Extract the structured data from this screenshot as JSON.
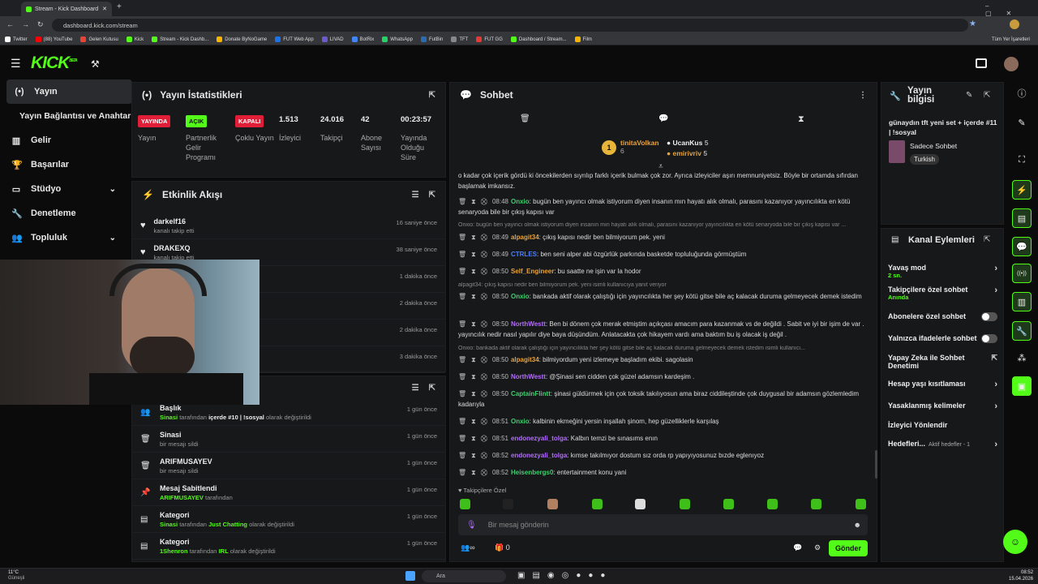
{
  "browser": {
    "tab_title": "Stream - Kick Dashboard",
    "url": "dashboard.kick.com/stream",
    "bookmarks": [
      "Twitter",
      "(88) YouTube",
      "Gelen Kutusu",
      "Kick",
      "Stream - Kick Dashb...",
      "Donate ByNoGame",
      "FUT Web App",
      "LIVAD",
      "BotRix",
      "WhatsApp",
      "FutBin",
      "TFT",
      "FUT GG",
      "Dashboard / Stream...",
      "Film"
    ],
    "all_bookmarks": "Tüm Yer İşaretleri"
  },
  "app": {
    "logo": "KICK",
    "beta": "BETA"
  },
  "sidebar": {
    "items": [
      {
        "label": "Yayın",
        "icon": "(•)"
      },
      {
        "label": "Yayın Bağlantısı ve Anahtarı",
        "icon": ""
      },
      {
        "label": "Gelir",
        "icon": "▥"
      },
      {
        "label": "Başarılar",
        "icon": "🏆"
      },
      {
        "label": "Stüdyo",
        "icon": "▭"
      },
      {
        "label": "Denetleme",
        "icon": "🔧"
      },
      {
        "label": "Topluluk",
        "icon": "👥"
      }
    ]
  },
  "stats": {
    "title": "Yayın İstatistikleri",
    "items": [
      {
        "badge": "YAYINDA",
        "label": "Yayın"
      },
      {
        "badge": "AÇIK",
        "label": "Partnerlik Gelir Programı"
      },
      {
        "badge": "KAPALI",
        "label": "Çoklu Yayın"
      },
      {
        "value": "1.513",
        "label": "İzleyici"
      },
      {
        "value": "24.016",
        "label": "Takipçi"
      },
      {
        "value": "42",
        "label": "Abone Sayısı"
      },
      {
        "value": "00:23:57",
        "label": "Yayında Olduğu Süre"
      }
    ]
  },
  "activity": {
    "title": "Etkinlik Akışı",
    "items": [
      {
        "name": "darkelf16",
        "sub": "kanalı takip etti",
        "time": "16 saniye önce"
      },
      {
        "name": "DRAKEXQ",
        "sub": "kanalı takip etti",
        "time": "38 saniye önce"
      },
      {
        "name": "",
        "sub": "",
        "time": "1 dakika önce"
      },
      {
        "name": "",
        "sub": "",
        "time": "2 dakika önce"
      },
      {
        "name": "",
        "sub": "",
        "time": "2 dakika önce"
      },
      {
        "name": "",
        "sub": "",
        "time": "3 dakika önce"
      }
    ]
  },
  "modlog": {
    "items": [
      {
        "name": "Başlık",
        "sub_user": "Sinasi",
        "sub_text": "tarafından",
        "sub_bold": "içerde #10 | !sosyal",
        "sub_end": "olarak değiştirildi",
        "time": "1 gün önce",
        "icon": "👥"
      },
      {
        "name": "Sinasi",
        "sub_text": "bir mesajı sildi",
        "time": "1 gün önce",
        "icon": "🗑"
      },
      {
        "name": "ARIFMUSAYEV",
        "sub_text": "bir mesajı sildi",
        "time": "1 gün önce",
        "icon": "🗑"
      },
      {
        "name": "Mesaj Sabitlendi",
        "sub_user": "ARIFMUSAYEV",
        "sub_text": "tarafından",
        "time": "1 gün önce",
        "icon": "📌"
      },
      {
        "name": "Kategori",
        "sub_user": "Sinasi",
        "sub_text": "tarafından",
        "sub_bold": "Just Chatting",
        "sub_end": "olarak değiştirildi",
        "time": "1 gün önce",
        "icon": "▤"
      },
      {
        "name": "Kategori",
        "sub_user": "1Shenron",
        "sub_text": "tarafından",
        "sub_bold": "IRL",
        "sub_end": "olarak değiştirildi",
        "time": "1 gün önce",
        "icon": "▤"
      }
    ]
  },
  "chat": {
    "title": "Sohbet",
    "top1": {
      "name": "tinitaVolkan",
      "count": "6"
    },
    "top2": {
      "name": "UcanKus",
      "count": "5"
    },
    "top3": {
      "name": "emirivriv",
      "count": "5"
    },
    "first_line": "o kadar çok içerik gördü ki öncekilerden sıyrılıp farklı içerik bulmak çok zor. Ayrıca izleyiciler aşırı memnuniyetsiz. Böyle bir ortamda sıfırdan başlamak imkansız.",
    "messages": [
      {
        "time": "08:48",
        "user": "Onxio",
        "color": "#3fcf6f",
        "text": "bugün ben yayıncı olmak istiyorum diyen insanın mın hayatı alık olmalı, parasını kazanıyor yayıncılıkta en kötü senaryoda bile bir çıkış kapısı var"
      },
      {
        "time": "08:49",
        "user": "alpagit34",
        "color": "#e8a33b",
        "text": "çıkış kapısı nedir ben bilmiyorum pek. yeni"
      },
      {
        "time": "08:49",
        "user": "CTRLES",
        "color": "#4a7eff",
        "text": "ben seni alper abi özgürlük parkında basketde topluluğunda görmüştüm"
      },
      {
        "time": "08:50",
        "user": "Self_Engineer",
        "color": "#e8a33b",
        "text": "bu saatte ne işin var la hodor"
      },
      {
        "time": "08:50",
        "user": "Onxio",
        "color": "#3fcf6f",
        "text": "bankada aktif olarak çalıştığı için yayıncılıkta her şey kötü gitse bile aç kalacak duruma gelmeyecek demek istedim"
      },
      {
        "time": "08:50",
        "user": "NorthWestt",
        "color": "#b36bff",
        "text": "Ben bi dönem çok merak etmiştim açıkçası amacım para kazanmak vs de değildi . Sabit ve iyi bir işim de var . yayıncılık nedir nasıl yapılır diye baya düşündüm. Anlatacakta çok hikayem vardı ama baktım bu iş olacak iş değil ."
      },
      {
        "time": "08:50",
        "user": "alpagit34",
        "color": "#e8a33b",
        "text": "bilmiyordum yeni izlemeye başladım ekibi. sagolasin"
      },
      {
        "time": "08:50",
        "user": "NorthWestt",
        "color": "#b36bff",
        "text": "@Şinasi sen cidden çok güzel adamsın kardeşim ."
      },
      {
        "time": "08:50",
        "user": "CaptainFlintt",
        "color": "#3fcf6f",
        "text": "şinasi güldürmek için çok toksik takılıyosun ama biraz ciddileştinde çok duygusal bir adamsın gözlemledim kadarıyla"
      },
      {
        "time": "08:51",
        "user": "Onxio",
        "color": "#3fcf6f",
        "text": "kalbinin ekmeğini yersin inşallah şinom, hep güzelliklerle karşılaş"
      },
      {
        "time": "08:51",
        "user": "endonezyali_tolga",
        "color": "#b36bff",
        "text": "Kalbın temzi be sınasıms enın"
      },
      {
        "time": "08:52",
        "user": "endonezyali_tolga",
        "color": "#b36bff",
        "text": "kımse takılmıyor dostum sız orda rp yapıyıyosunuz bızde eglenıyoz"
      },
      {
        "time": "08:52",
        "user": "Heisenbergs0",
        "color": "#3fcf6f",
        "text": "entertainment konu yani"
      }
    ],
    "replies": [
      "Onxio: bugün ben yayıncı olmak istiyorum diyen insanın mın hayatı alık olmalı, parasını kazanıyor yayıncılıkta en kötü senaryoda bile bir çıkış kapısı var ...",
      "alpagit34: çıkış kapısı nedir ben bilmiyorum pek. yeni isimli kullanıcıya yanıt veriyor",
      "Onxio: bankada aktif olarak çalıştığı için yayıncılıkta her şey kötü gitse bile aç kalacak duruma gelmeyecek demek istedim isimli kullanıcı..."
    ],
    "followers_only": "Takipçilere Özel",
    "input_placeholder": "Bir mesaj gönderin",
    "send_label": "Gönder",
    "pts": "0"
  },
  "streaminfo": {
    "title": "Yayın bilgisi",
    "stream_title": "günaydın tft yeni set + içerde #11 | !sosyal",
    "category": "Sadece Sohbet",
    "language": "Turkish"
  },
  "channel": {
    "title": "Kanal Eylemleri",
    "actions": [
      {
        "label": "Yavaş mod",
        "sub": "2 sn.",
        "kind": "chev"
      },
      {
        "label": "Takipçilere özel sohbet",
        "sub": "Anında",
        "kind": "chev"
      },
      {
        "label": "Abonelere özel sohbet",
        "kind": "toggle"
      },
      {
        "label": "Yalnızca ifadelerle sohbet",
        "kind": "toggle"
      },
      {
        "label": "Yapay Zeka ile Sohbet Denetimi",
        "kind": "ext"
      },
      {
        "label": "Hesap yaşı kısıtlaması",
        "kind": "chev"
      },
      {
        "label": "Yasaklanmış kelimeler",
        "kind": "chev"
      },
      {
        "label": "İzleyici Yönlendir",
        "kind": "none"
      },
      {
        "label": "Hedefleri...",
        "sub": "Aktif hedefler - 1",
        "kind": "chev"
      }
    ]
  },
  "taskbar": {
    "weather": "11°C",
    "weather_sub": "Güneşli",
    "search": "Ara",
    "time": "08:52",
    "date": "15.04.2026"
  },
  "colors": {
    "accent": "#53fc18",
    "live": "#e01e37",
    "on": "#53fc18"
  }
}
